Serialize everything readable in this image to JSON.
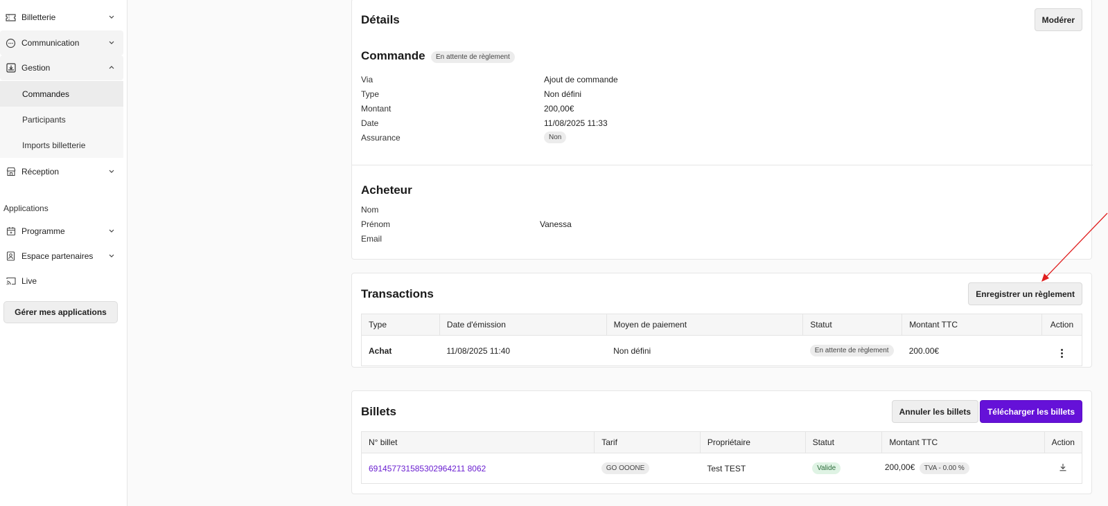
{
  "sidebar": {
    "items": [
      {
        "label": "Billetterie",
        "icon": "ticket-icon"
      },
      {
        "label": "Communication",
        "icon": "chat-icon"
      },
      {
        "label": "Gestion",
        "icon": "inbox-download-icon"
      },
      {
        "label": "Réception",
        "icon": "store-icon"
      }
    ],
    "gestion_sub": [
      {
        "label": "Commandes"
      },
      {
        "label": "Participants"
      },
      {
        "label": "Imports billetterie"
      }
    ],
    "applications_label": "Applications",
    "app_items": [
      {
        "label": "Programme",
        "icon": "calendar-icon"
      },
      {
        "label": "Espace partenaires",
        "icon": "badge-icon"
      },
      {
        "label": "Live",
        "icon": "cast-icon"
      }
    ],
    "manage_button": "Gérer mes applications"
  },
  "details": {
    "title": "Détails",
    "moderate_button": "Modérer",
    "order": {
      "title": "Commande",
      "status": "En attente de règlement",
      "fields": [
        {
          "label": "Via",
          "value": "Ajout de commande"
        },
        {
          "label": "Type",
          "value": "Non défini"
        },
        {
          "label": "Montant",
          "value": "200,00€"
        },
        {
          "label": "Date",
          "value": "11/08/2025 11:33"
        },
        {
          "label": "Assurance",
          "value": "Non"
        }
      ]
    },
    "buyer": {
      "title": "Acheteur",
      "fields": [
        {
          "label": "Nom",
          "value": ""
        },
        {
          "label": "Prénom",
          "value": "Vanessa"
        },
        {
          "label": "Email",
          "value": ""
        }
      ]
    }
  },
  "transactions": {
    "title": "Transactions",
    "register_button": "Enregistrer un règlement",
    "columns": [
      "Type",
      "Date d'émission",
      "Moyen de paiement",
      "Statut",
      "Montant TTC",
      "Action"
    ],
    "rows": [
      {
        "type": "Achat",
        "date": "11/08/2025 11:40",
        "payment": "Non défini",
        "status": "En attente de règlement",
        "amount": "200.00€"
      }
    ]
  },
  "billets": {
    "title": "Billets",
    "cancel_button": "Annuler les billets",
    "download_button": "Télécharger les billets",
    "columns": [
      "N° billet",
      "Tarif",
      "Propriétaire",
      "Statut",
      "Montant TTC",
      "Action"
    ],
    "rows": [
      {
        "number": "691457731585302964211 8062",
        "tarif": "GO OOONE",
        "owner": "Test TEST",
        "status": "Valide",
        "amount": "200,00€",
        "tva": "TVA - 0.00 %"
      }
    ]
  },
  "colors": {
    "accent": "#6511d8",
    "annotation_arrow": "#e02020"
  }
}
